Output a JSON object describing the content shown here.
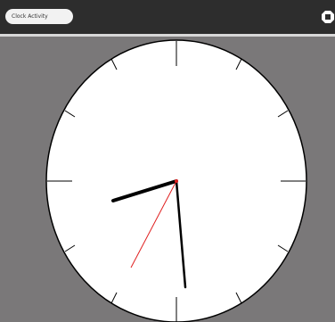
{
  "toolbar": {
    "activity_title": "Clock Activity",
    "stop_icon": "stop-icon"
  },
  "clock": {
    "face_color": "#ffffff",
    "background_color": "#7a7879",
    "ticks": 12,
    "hands": {
      "hour": {
        "color": "#000000"
      },
      "minute": {
        "color": "#000000"
      },
      "second": {
        "color": "#e02020"
      }
    }
  }
}
